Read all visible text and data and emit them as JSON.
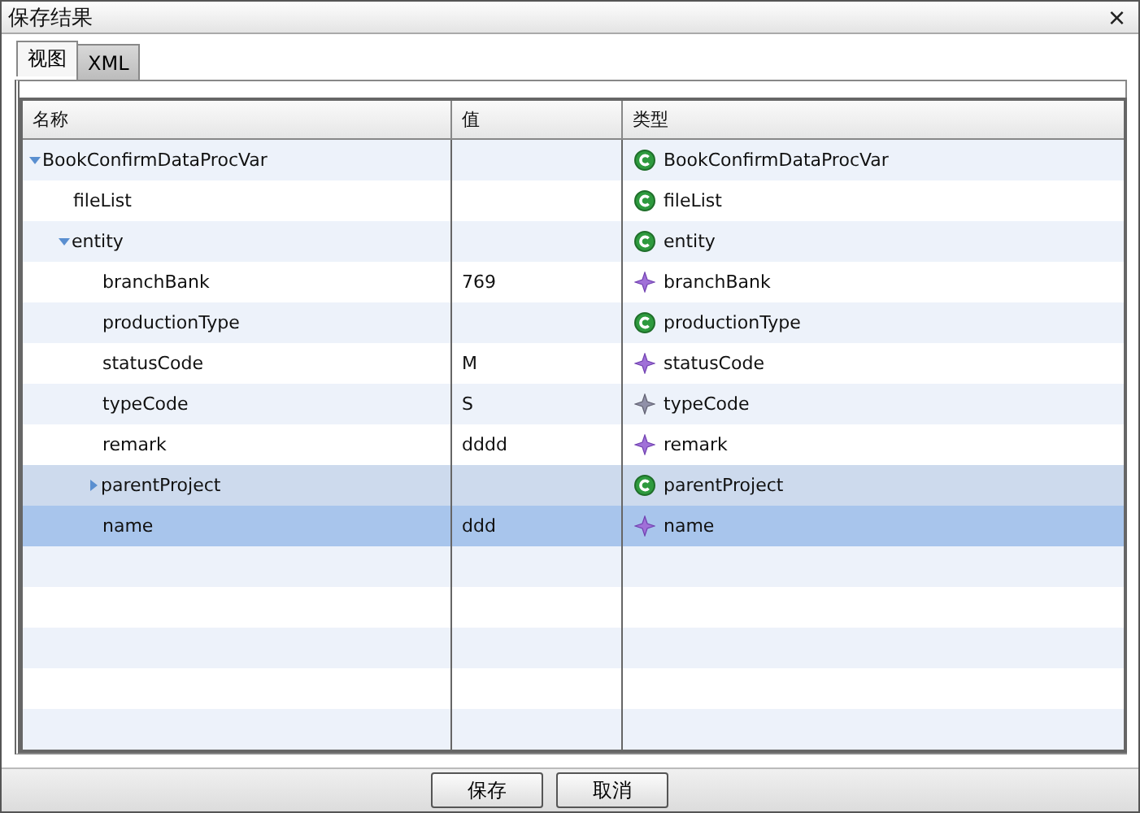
{
  "window": {
    "title": "保存结果",
    "close": "×"
  },
  "tabs": [
    {
      "label": "视图",
      "selected": true
    },
    {
      "label": "XML",
      "selected": false
    }
  ],
  "table": {
    "columns": [
      "名称",
      "值",
      "类型"
    ],
    "rows": [
      {
        "name": "BookConfirmDataProcVar",
        "type": "BookConfirmDataProcVar",
        "kind": "class",
        "expanded": true,
        "selected": false,
        "hovered": false,
        "children": [
          {
            "name": "fileList",
            "type": "fileList",
            "kind": "class",
            "selected": false,
            "hovered": false
          },
          {
            "name": "entity",
            "type": "entity",
            "kind": "class",
            "expanded": true,
            "selected": false,
            "hovered": false,
            "children": [
              {
                "name": "branchBank",
                "value": "769",
                "type": "branchBank",
                "kind": "field",
                "selected": false,
                "hovered": false
              },
              {
                "name": "productionType",
                "type": "productionType",
                "kind": "class",
                "selected": false,
                "hovered": false
              },
              {
                "name": "statusCode",
                "value": "M",
                "type": "statusCode",
                "kind": "field",
                "selected": false,
                "hovered": false
              },
              {
                "name": "typeCode",
                "value": "S",
                "type": "typeCode",
                "kind": "constant",
                "selected": false,
                "hovered": false
              },
              {
                "name": "remark",
                "value": "dddd",
                "type": "remark",
                "kind": "field",
                "selected": false,
                "hovered": false
              },
              {
                "name": "parentProject",
                "type": "parentProject",
                "kind": "class",
                "expanded": false,
                "selected": false,
                "hovered": true
              },
              {
                "name": "name",
                "value": "ddd",
                "type": "name",
                "kind": "field",
                "selected": true,
                "hovered": false
              }
            ]
          }
        ]
      }
    ]
  },
  "buttons": [
    "保存",
    "取消"
  ]
}
